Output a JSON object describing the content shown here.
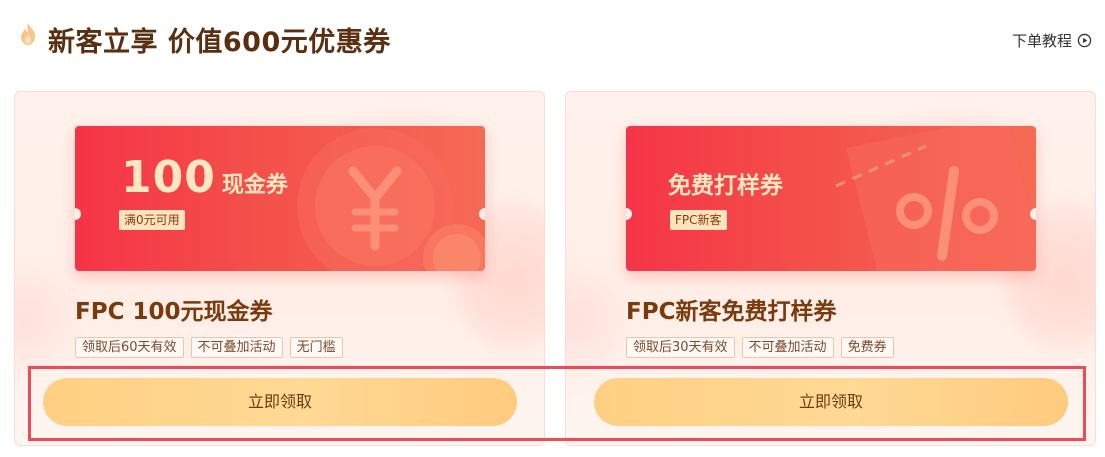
{
  "header": {
    "title": "新客立享 价值600元优惠券",
    "tutorial_label": "下单教程",
    "flame_icon": "flame-icon",
    "play_icon": "play-circle-icon"
  },
  "coupons": [
    {
      "amount": "100",
      "amount_unit": "现金券",
      "condition": "满0元可用",
      "title": "FPC 100元现金券",
      "tags": [
        "领取后60天有效",
        "不可叠加活动",
        "无门槛"
      ],
      "button_label": "立即领取",
      "decor_icon": "yuan-coin-icon"
    },
    {
      "ticket_name": "免费打样券",
      "condition": "FPC新客",
      "title": "FPC新客免费打样券",
      "tags": [
        "领取后30天有效",
        "不可叠加活动",
        "免费券"
      ],
      "button_label": "立即领取",
      "decor_icon": "percent-tag-icon"
    }
  ],
  "colors": {
    "ticket_red": "#f53447",
    "button_gold": "#ffd083",
    "title_brown": "#5a2e0e",
    "highlight_red": "#ee4b55"
  }
}
